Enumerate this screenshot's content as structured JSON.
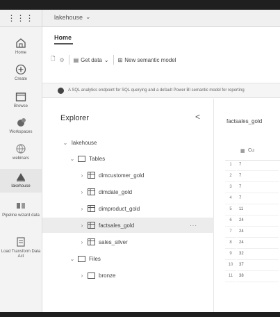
{
  "app": {
    "workspace_label": "lakehouse",
    "workspace_chevron": "chevron-down-icon"
  },
  "rail": {
    "items": [
      {
        "label": "Home",
        "icon": "home-icon"
      },
      {
        "label": "Create",
        "icon": "plus-circle-icon"
      },
      {
        "label": "Browse",
        "icon": "folder-icon"
      },
      {
        "label": "Workspaces",
        "icon": "workspaces-icon"
      },
      {
        "label": "webinars",
        "icon": "globe-icon"
      },
      {
        "label": "lakehouse",
        "icon": "lakehouse-icon"
      },
      {
        "label": "Pipeline wizard data",
        "icon": "pipeline-icon"
      },
      {
        "label": "Load Transform Data Act",
        "icon": "load-icon"
      }
    ]
  },
  "header": {
    "tab": "Home"
  },
  "toolbar": {
    "get_data": "Get data",
    "new_semantic_model": "New semantic model"
  },
  "infobar": {
    "text": "A SQL analytics endpoint for SQL querying and a default Power BI semantic model for reporting"
  },
  "explorer": {
    "title": "Explorer",
    "root": "lakehouse",
    "tables_label": "Tables",
    "tables": [
      "dimcustomer_gold",
      "dimdate_gold",
      "dimproduct_gold",
      "factsales_gold",
      "sales_silver"
    ],
    "selected_table": "factsales_gold",
    "files_label": "Files",
    "files": [
      "bronze"
    ]
  },
  "preview": {
    "title": "factsales_gold",
    "column_header": "Cu",
    "row_numbers": [
      "1",
      "2",
      "3",
      "4",
      "5",
      "6",
      "7",
      "8",
      "9",
      "10",
      "11"
    ],
    "values": [
      "7",
      "7",
      "7",
      "7",
      "11",
      "24",
      "24",
      "24",
      "32",
      "37",
      "38"
    ]
  },
  "colors": {
    "frame": "#1f1f1f",
    "rail_bg": "#f3f3f3",
    "selected_row": "#ececec",
    "accent": "#444444"
  }
}
